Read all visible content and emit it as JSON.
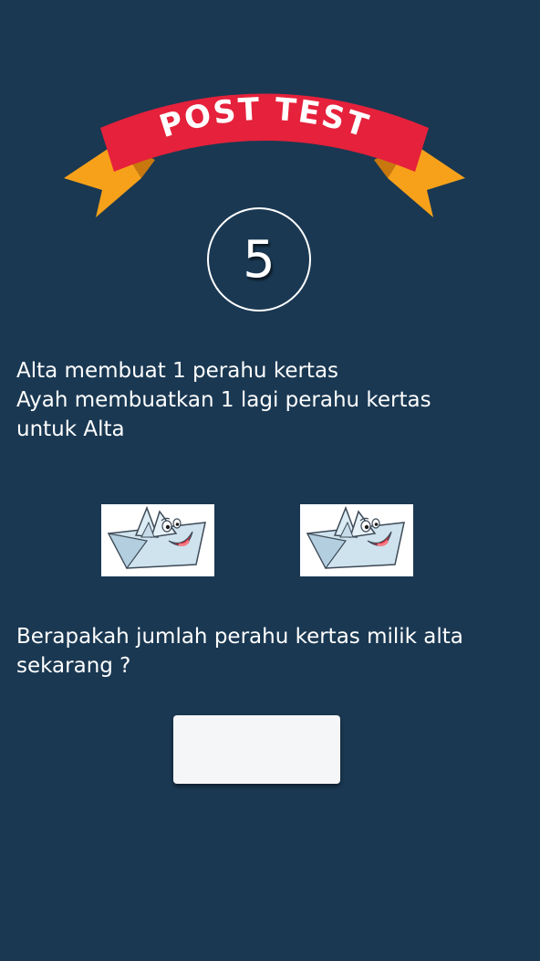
{
  "banner": {
    "title": "POST TEST",
    "colors": {
      "ribbon_red": "#e5213b",
      "ribbon_dark_red": "#a8132a",
      "ribbon_orange": "#f7a11a",
      "ribbon_dark_orange": "#c8780e"
    }
  },
  "question_number": "5",
  "question": {
    "lines": [
      "Alta membuat 1 perahu kertas",
      "Ayah membuatkan 1 lagi perahu kertas",
      "untuk Alta"
    ],
    "prompt_lines": [
      "Berapakah jumlah perahu kertas milik alta",
      "sekarang ?"
    ]
  },
  "images": {
    "boat_icon": "paper-boat-cartoon-icon",
    "count": 2
  },
  "answer": {
    "value": ""
  },
  "colors": {
    "background": "#1a3852",
    "text": "#ffffff",
    "answer_box": "#f5f6f8"
  }
}
